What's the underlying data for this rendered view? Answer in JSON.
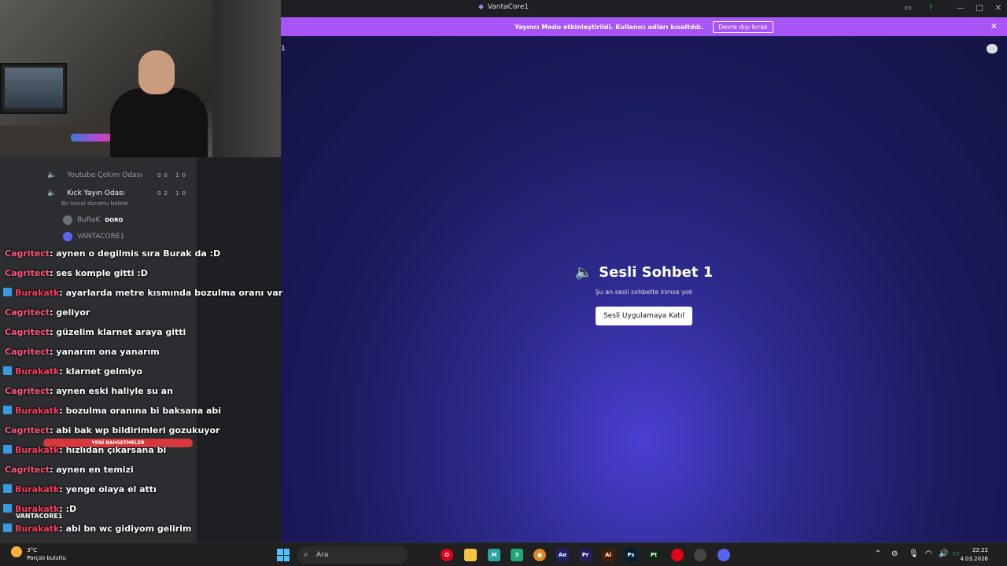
{
  "window": {
    "title": "VantaCore1"
  },
  "banner": {
    "message": "Yayıncı Modu etkinleştirildi. Kullanıcı adları kısaltıldı.",
    "disable_button": "Devre dışı bırak"
  },
  "main": {
    "indicator": "1",
    "heading": "Sesli Sohbet 1",
    "subtitle": "Şu an sesli sohbette kimse yok",
    "join_button": "Sesli Uygulamaya Katıl"
  },
  "sidebar": {
    "channels": [
      {
        "label": "Youtube Çekim Odası",
        "count": "00 10"
      },
      {
        "label": "Kıck Yayın Odası",
        "count": "02 10"
      }
    ],
    "channel_status": "Bir kanal durumu belirle",
    "members": [
      {
        "name": "BuRaK",
        "tag": "DORO"
      },
      {
        "name": "VANTACORE1",
        "tag": ""
      }
    ],
    "mentions_label": "YENİ BAHSETMELER",
    "current_user": "VANTACORE1"
  },
  "chat": {
    "messages": [
      {
        "user": "Cagritect",
        "kind": "c",
        "text": ": aynen o degilmis sıra Burak da :D"
      },
      {
        "user": "Cagritect",
        "kind": "c",
        "text": ": ses komple gitti :D"
      },
      {
        "user": "Burakatk",
        "kind": "b",
        "text": ": ayarlarda metre kısmında bozulma oranı var"
      },
      {
        "user": "Cagritect",
        "kind": "c",
        "text": ": geliyor"
      },
      {
        "user": "Cagritect",
        "kind": "c",
        "text": ": güzelim klarnet araya gitti"
      },
      {
        "user": "Cagritect",
        "kind": "c",
        "text": ": yanarım ona yanarım"
      },
      {
        "user": "Burakatk",
        "kind": "b",
        "text": ": klarnet gelmiyo"
      },
      {
        "user": "Cagritect",
        "kind": "c",
        "text": ": aynen eski haliyle su an"
      },
      {
        "user": "Burakatk",
        "kind": "b",
        "text": ": bozulma oranına bi baksana abi"
      },
      {
        "user": "Cagritect",
        "kind": "c",
        "text": ": abi bak wp bildirimleri gozukuyor"
      },
      {
        "user": "Burakatk",
        "kind": "b",
        "text": ": hızlıdan çıkarsana bi"
      },
      {
        "user": "Cagritect",
        "kind": "c",
        "text": ": aynen en temizi"
      },
      {
        "user": "Burakatk",
        "kind": "b",
        "text": ": yenge olaya el attı"
      },
      {
        "user": "Burakatk",
        "kind": "b",
        "text": ": :D"
      },
      {
        "user": "Burakatk",
        "kind": "b",
        "text": ": abi bn wc gidiyom gelirim"
      }
    ]
  },
  "taskbar": {
    "weather_temp": "3°C",
    "weather_desc": "Parçalı bulutlu",
    "search_placeholder": "Ara",
    "time": "22:22",
    "date": "4.03.2026",
    "apps": [
      {
        "name": "file-explorer-icon",
        "glyph": "",
        "color": "#f5c242"
      },
      {
        "name": "adobe-ae-icon",
        "glyph": "Ae",
        "color": "#1f1f6b"
      },
      {
        "name": "adobe-pr-icon",
        "glyph": "Pr",
        "color": "#2a1a5e"
      },
      {
        "name": "adobe-ai-icon",
        "glyph": "Ai",
        "color": "#4a1f00"
      },
      {
        "name": "adobe-ps-icon",
        "glyph": "Ps",
        "color": "#001e36"
      },
      {
        "name": "adobe-pt-icon",
        "glyph": "Pt",
        "color": "#0e2a12"
      }
    ]
  }
}
